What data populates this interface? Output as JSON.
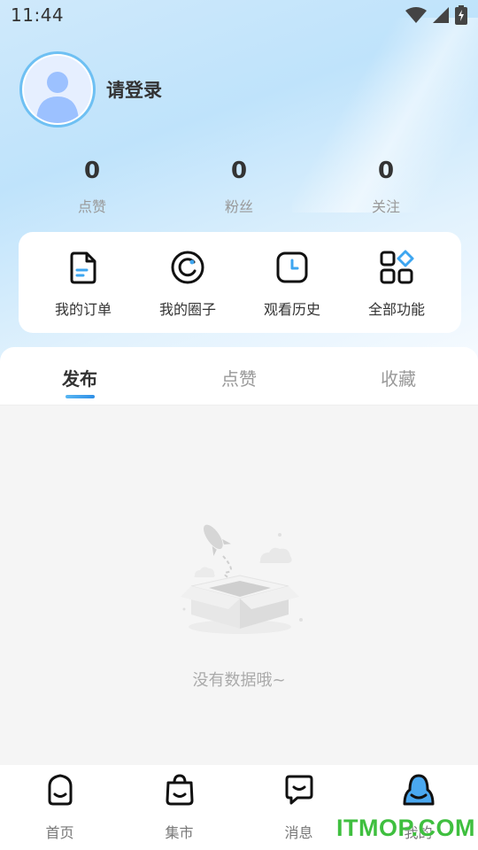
{
  "status_bar": {
    "time": "11:44"
  },
  "profile": {
    "login_prompt": "请登录"
  },
  "stats": [
    {
      "value": "0",
      "label": "点赞"
    },
    {
      "value": "0",
      "label": "粉丝"
    },
    {
      "value": "0",
      "label": "关注"
    }
  ],
  "quick_actions": [
    {
      "label": "我的订单",
      "icon": "order-document-icon"
    },
    {
      "label": "我的圈子",
      "icon": "circle-icon"
    },
    {
      "label": "观看历史",
      "icon": "clock-icon"
    },
    {
      "label": "全部功能",
      "icon": "grid-apps-icon"
    }
  ],
  "content_tabs": [
    {
      "label": "发布",
      "active": true
    },
    {
      "label": "点赞",
      "active": false
    },
    {
      "label": "收藏",
      "active": false
    }
  ],
  "empty_state": {
    "message": "没有数据哦~"
  },
  "bottom_nav": [
    {
      "label": "首页",
      "icon": "home-icon",
      "active": false
    },
    {
      "label": "集市",
      "icon": "shopping-bag-icon",
      "active": false
    },
    {
      "label": "消息",
      "icon": "message-icon",
      "active": false
    },
    {
      "label": "我的",
      "icon": "person-icon",
      "active": true
    }
  ],
  "watermark": "ITMOP.COM",
  "colors": {
    "accent": "#2f8fe6",
    "watermark": "#3fbf3f"
  }
}
